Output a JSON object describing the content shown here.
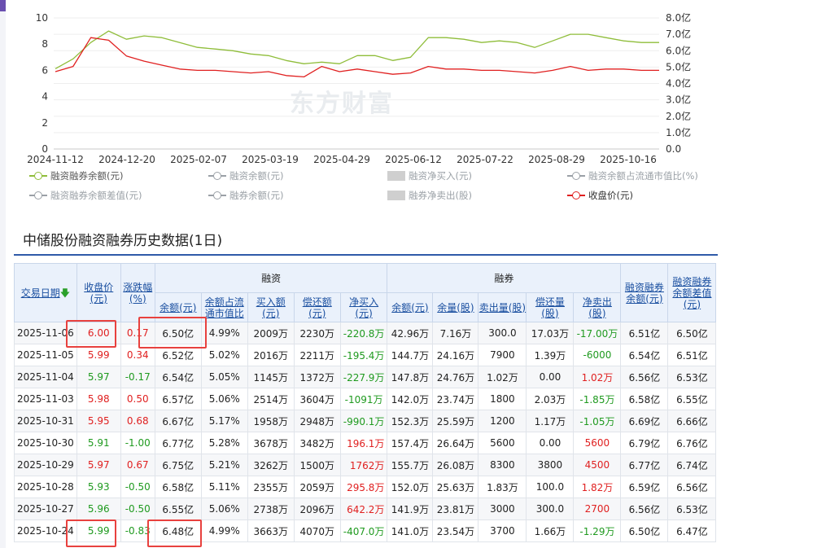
{
  "chart_data": {
    "type": "line",
    "x_tick_labels": [
      "2024-11-12",
      "2024-12-20",
      "2025-02-07",
      "2025-03-19",
      "2025-04-29",
      "2025-06-12",
      "2025-07-22",
      "2025-08-29",
      "2025-10-16"
    ],
    "y_left_ticks": [
      "10",
      "8",
      "6",
      "4",
      "2",
      "0"
    ],
    "y_right_ticks": [
      "8.0亿",
      "7.0亿",
      "6.0亿",
      "5.0亿",
      "4.0亿",
      "3.0亿",
      "2.0亿",
      "1.0亿",
      "0.0"
    ],
    "ylim_left": [
      0,
      10
    ],
    "ylim_right": [
      0,
      8
    ],
    "series": [
      {
        "name": "融资融券余额(元)",
        "axis": "right",
        "color": "#8fbd3a",
        "values": [
          4.9,
          5.5,
          6.5,
          7.2,
          6.7,
          6.9,
          6.8,
          6.5,
          6.2,
          6.1,
          6.0,
          5.8,
          5.7,
          5.4,
          5.2,
          5.3,
          5.2,
          5.7,
          5.7,
          5.4,
          5.6,
          6.8,
          6.8,
          6.7,
          6.5,
          6.6,
          6.5,
          6.2,
          6.6,
          7.0,
          7.0,
          6.8,
          6.6,
          6.5,
          6.5
        ]
      },
      {
        "name": "收盘价(元)",
        "axis": "left",
        "color": "#e02020",
        "values": [
          5.9,
          6.3,
          8.5,
          8.3,
          7.1,
          6.7,
          6.4,
          6.1,
          6.0,
          6.0,
          5.9,
          5.8,
          5.9,
          5.6,
          5.5,
          6.3,
          5.9,
          6.1,
          5.9,
          5.7,
          5.8,
          6.3,
          6.1,
          6.1,
          6.0,
          6.0,
          5.9,
          5.8,
          6.0,
          6.3,
          6.0,
          6.1,
          6.1,
          6.0,
          6.0
        ]
      }
    ],
    "legend_position": "bottom",
    "grid": true
  },
  "legend": {
    "items": [
      {
        "label": "融资融券余额(元)",
        "style": "green"
      },
      {
        "label": "融资余额(元)",
        "style": "off"
      },
      {
        "label": "融资净买入(元)",
        "style": "bar"
      },
      {
        "label": "融资余额占流通市值比(%)",
        "style": "off"
      },
      {
        "label": "融资融券余额差值(元)",
        "style": "off"
      },
      {
        "label": "融券余额(元)",
        "style": "off"
      },
      {
        "label": "融券净卖出(股)",
        "style": "bar"
      },
      {
        "label": "收盘价(元)",
        "style": "red"
      }
    ]
  },
  "watermark": "东方财富",
  "section_title": "中储股份融资融券历史数据(1日)",
  "table": {
    "group_headers": {
      "rz": "融资",
      "rq": "融券"
    },
    "headers": {
      "date": "交易日期",
      "close": "收盘价(元)",
      "change": "涨跌幅(%)",
      "rz_balance": "余额(元)",
      "rz_ratio": "余额占流通市值比",
      "rz_buy": "买入额(元)",
      "rz_repay": "偿还额(元)",
      "rz_net": "净买入(元)",
      "rq_balance": "余额(元)",
      "rq_volume": "余量(股)",
      "rq_sell": "卖出量(股)",
      "rq_repay": "偿还量(股)",
      "rq_net": "净卖出(股)",
      "total": "融资融券余额(元)",
      "diff": "融资融券余额差值(元)"
    },
    "rows": [
      {
        "date": "2025-11-06",
        "close": "6.00",
        "close_dir": "up",
        "change": "0.17",
        "change_dir": "up",
        "rz_balance": "6.50亿",
        "rz_ratio": "4.99%",
        "rz_buy": "2009万",
        "rz_repay": "2230万",
        "rz_net": "-220.8万",
        "rz_net_dir": "down",
        "rq_balance": "42.96万",
        "rq_volume": "7.16万",
        "rq_sell": "300.0",
        "rq_repay": "17.03万",
        "rq_net": "-17.00万",
        "rq_net_dir": "down",
        "total": "6.51亿",
        "diff": "6.50亿"
      },
      {
        "date": "2025-11-05",
        "close": "5.99",
        "close_dir": "up",
        "change": "0.34",
        "change_dir": "up",
        "rz_balance": "6.52亿",
        "rz_ratio": "5.02%",
        "rz_buy": "2016万",
        "rz_repay": "2211万",
        "rz_net": "-195.4万",
        "rz_net_dir": "down",
        "rq_balance": "144.7万",
        "rq_volume": "24.16万",
        "rq_sell": "7900",
        "rq_repay": "1.39万",
        "rq_net": "-6000",
        "rq_net_dir": "down",
        "total": "6.54亿",
        "diff": "6.51亿"
      },
      {
        "date": "2025-11-04",
        "close": "5.97",
        "close_dir": "down",
        "change": "-0.17",
        "change_dir": "down",
        "rz_balance": "6.54亿",
        "rz_ratio": "5.05%",
        "rz_buy": "1145万",
        "rz_repay": "1372万",
        "rz_net": "-227.9万",
        "rz_net_dir": "down",
        "rq_balance": "147.8万",
        "rq_volume": "24.76万",
        "rq_sell": "1.02万",
        "rq_repay": "0.00",
        "rq_net": "1.02万",
        "rq_net_dir": "up",
        "total": "6.56亿",
        "diff": "6.53亿"
      },
      {
        "date": "2025-11-03",
        "close": "5.98",
        "close_dir": "up",
        "change": "0.50",
        "change_dir": "up",
        "rz_balance": "6.57亿",
        "rz_ratio": "5.06%",
        "rz_buy": "2514万",
        "rz_repay": "3604万",
        "rz_net": "-1091万",
        "rz_net_dir": "down",
        "rq_balance": "142.0万",
        "rq_volume": "23.74万",
        "rq_sell": "1800",
        "rq_repay": "2.03万",
        "rq_net": "-1.85万",
        "rq_net_dir": "down",
        "total": "6.58亿",
        "diff": "6.55亿"
      },
      {
        "date": "2025-10-31",
        "close": "5.95",
        "close_dir": "up",
        "change": "0.68",
        "change_dir": "up",
        "rz_balance": "6.67亿",
        "rz_ratio": "5.17%",
        "rz_buy": "1958万",
        "rz_repay": "2948万",
        "rz_net": "-990.1万",
        "rz_net_dir": "down",
        "rq_balance": "152.3万",
        "rq_volume": "25.59万",
        "rq_sell": "1200",
        "rq_repay": "1.17万",
        "rq_net": "-1.05万",
        "rq_net_dir": "down",
        "total": "6.69亿",
        "diff": "6.66亿"
      },
      {
        "date": "2025-10-30",
        "close": "5.91",
        "close_dir": "down",
        "change": "-1.00",
        "change_dir": "down",
        "rz_balance": "6.77亿",
        "rz_ratio": "5.28%",
        "rz_buy": "3678万",
        "rz_repay": "3482万",
        "rz_net": "196.1万",
        "rz_net_dir": "up",
        "rq_balance": "157.4万",
        "rq_volume": "26.64万",
        "rq_sell": "5600",
        "rq_repay": "0.00",
        "rq_net": "5600",
        "rq_net_dir": "up",
        "total": "6.79亿",
        "diff": "6.76亿"
      },
      {
        "date": "2025-10-29",
        "close": "5.97",
        "close_dir": "up",
        "change": "0.67",
        "change_dir": "up",
        "rz_balance": "6.75亿",
        "rz_ratio": "5.21%",
        "rz_buy": "3262万",
        "rz_repay": "1500万",
        "rz_net": "1762万",
        "rz_net_dir": "up",
        "rq_balance": "155.7万",
        "rq_volume": "26.08万",
        "rq_sell": "8300",
        "rq_repay": "3800",
        "rq_net": "4500",
        "rq_net_dir": "up",
        "total": "6.77亿",
        "diff": "6.74亿"
      },
      {
        "date": "2025-10-28",
        "close": "5.93",
        "close_dir": "down",
        "change": "-0.50",
        "change_dir": "down",
        "rz_balance": "6.58亿",
        "rz_ratio": "5.11%",
        "rz_buy": "2355万",
        "rz_repay": "2059万",
        "rz_net": "295.8万",
        "rz_net_dir": "up",
        "rq_balance": "152.0万",
        "rq_volume": "25.63万",
        "rq_sell": "1.83万",
        "rq_repay": "100.0",
        "rq_net": "1.82万",
        "rq_net_dir": "up",
        "total": "6.59亿",
        "diff": "6.56亿"
      },
      {
        "date": "2025-10-27",
        "close": "5.96",
        "close_dir": "down",
        "change": "-0.50",
        "change_dir": "down",
        "rz_balance": "6.55亿",
        "rz_ratio": "5.06%",
        "rz_buy": "2738万",
        "rz_repay": "2096万",
        "rz_net": "642.2万",
        "rz_net_dir": "up",
        "rq_balance": "141.9万",
        "rq_volume": "23.81万",
        "rq_sell": "3000",
        "rq_repay": "300.0",
        "rq_net": "2700",
        "rq_net_dir": "up",
        "total": "6.56亿",
        "diff": "6.53亿"
      },
      {
        "date": "2025-10-24",
        "close": "5.99",
        "close_dir": "down",
        "change": "-0.83",
        "change_dir": "down",
        "rz_balance": "6.48亿",
        "rz_ratio": "4.99%",
        "rz_buy": "3663万",
        "rz_repay": "4070万",
        "rz_net": "-407.0万",
        "rz_net_dir": "down",
        "rq_balance": "141.0万",
        "rq_volume": "23.54万",
        "rq_sell": "3700",
        "rq_repay": "1.66万",
        "rq_net": "-1.29万",
        "rq_net_dir": "down",
        "total": "6.50亿",
        "diff": "6.47亿"
      }
    ]
  }
}
